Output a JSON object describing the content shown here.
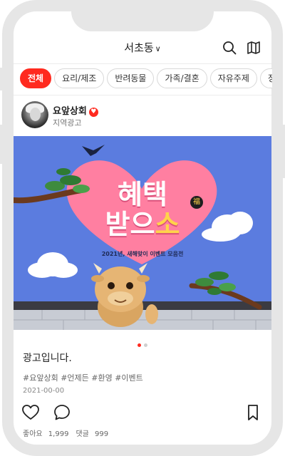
{
  "header": {
    "location": "서초동",
    "location_chevron": "∨",
    "search_icon": "search-icon",
    "map_icon": "map-icon"
  },
  "categories": [
    "전체",
    "요리/제조",
    "반려동물",
    "가족/결혼",
    "자유주제",
    "정보"
  ],
  "post": {
    "author": "요앞상회",
    "author_badge": "♥",
    "subtitle": "지역광고",
    "banner": {
      "title_line1": "혜택",
      "title_line2a": "받으",
      "title_line2b": "소",
      "seal": "福",
      "subtitle": "2021년, 새해맞이 이벤트 모음전"
    },
    "slide_count": 2,
    "active_slide": 1,
    "caption": "광고입니다.",
    "tags": "#요앞상회 #언제든 #환영 #이벤트",
    "date": "2021-00-00",
    "likes_label": "좋아요",
    "likes": "1,999",
    "comments_label": "댓글",
    "comments": "999"
  },
  "colors": {
    "accent": "#ff2a1f",
    "banner_bg": "#5b7cdf",
    "heart": "#ff7fa1"
  }
}
